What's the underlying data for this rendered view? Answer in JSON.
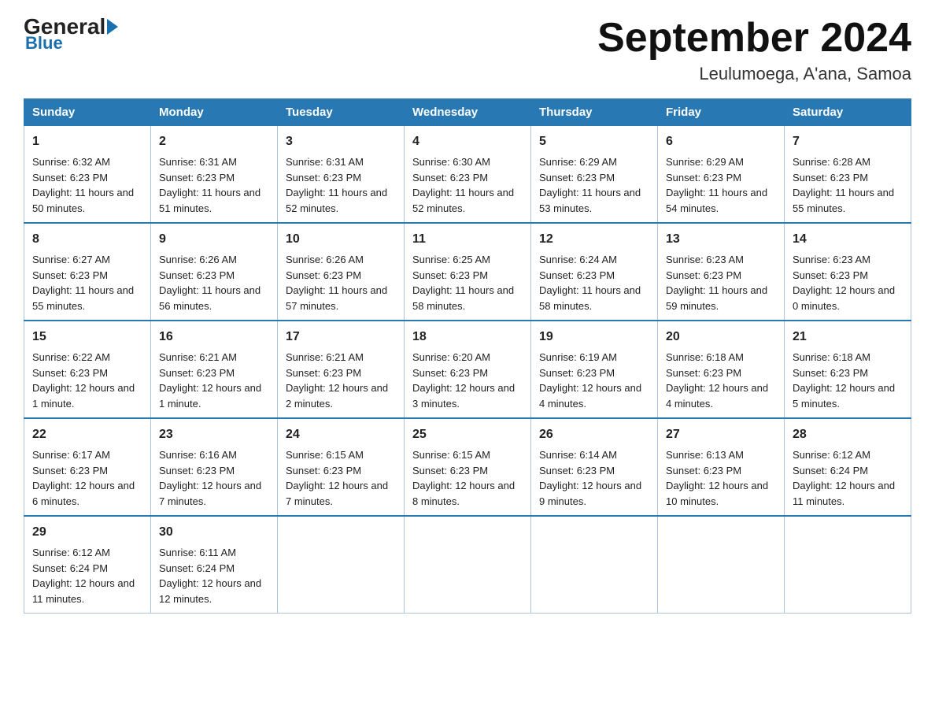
{
  "header": {
    "logo_main": "General",
    "logo_sub": "Blue",
    "title": "September 2024",
    "subtitle": "Leulumoega, A'ana, Samoa"
  },
  "days_of_week": [
    "Sunday",
    "Monday",
    "Tuesday",
    "Wednesday",
    "Thursday",
    "Friday",
    "Saturday"
  ],
  "weeks": [
    [
      {
        "day": "1",
        "sunrise": "6:32 AM",
        "sunset": "6:23 PM",
        "daylight": "11 hours and 50 minutes."
      },
      {
        "day": "2",
        "sunrise": "6:31 AM",
        "sunset": "6:23 PM",
        "daylight": "11 hours and 51 minutes."
      },
      {
        "day": "3",
        "sunrise": "6:31 AM",
        "sunset": "6:23 PM",
        "daylight": "11 hours and 52 minutes."
      },
      {
        "day": "4",
        "sunrise": "6:30 AM",
        "sunset": "6:23 PM",
        "daylight": "11 hours and 52 minutes."
      },
      {
        "day": "5",
        "sunrise": "6:29 AM",
        "sunset": "6:23 PM",
        "daylight": "11 hours and 53 minutes."
      },
      {
        "day": "6",
        "sunrise": "6:29 AM",
        "sunset": "6:23 PM",
        "daylight": "11 hours and 54 minutes."
      },
      {
        "day": "7",
        "sunrise": "6:28 AM",
        "sunset": "6:23 PM",
        "daylight": "11 hours and 55 minutes."
      }
    ],
    [
      {
        "day": "8",
        "sunrise": "6:27 AM",
        "sunset": "6:23 PM",
        "daylight": "11 hours and 55 minutes."
      },
      {
        "day": "9",
        "sunrise": "6:26 AM",
        "sunset": "6:23 PM",
        "daylight": "11 hours and 56 minutes."
      },
      {
        "day": "10",
        "sunrise": "6:26 AM",
        "sunset": "6:23 PM",
        "daylight": "11 hours and 57 minutes."
      },
      {
        "day": "11",
        "sunrise": "6:25 AM",
        "sunset": "6:23 PM",
        "daylight": "11 hours and 58 minutes."
      },
      {
        "day": "12",
        "sunrise": "6:24 AM",
        "sunset": "6:23 PM",
        "daylight": "11 hours and 58 minutes."
      },
      {
        "day": "13",
        "sunrise": "6:23 AM",
        "sunset": "6:23 PM",
        "daylight": "11 hours and 59 minutes."
      },
      {
        "day": "14",
        "sunrise": "6:23 AM",
        "sunset": "6:23 PM",
        "daylight": "12 hours and 0 minutes."
      }
    ],
    [
      {
        "day": "15",
        "sunrise": "6:22 AM",
        "sunset": "6:23 PM",
        "daylight": "12 hours and 1 minute."
      },
      {
        "day": "16",
        "sunrise": "6:21 AM",
        "sunset": "6:23 PM",
        "daylight": "12 hours and 1 minute."
      },
      {
        "day": "17",
        "sunrise": "6:21 AM",
        "sunset": "6:23 PM",
        "daylight": "12 hours and 2 minutes."
      },
      {
        "day": "18",
        "sunrise": "6:20 AM",
        "sunset": "6:23 PM",
        "daylight": "12 hours and 3 minutes."
      },
      {
        "day": "19",
        "sunrise": "6:19 AM",
        "sunset": "6:23 PM",
        "daylight": "12 hours and 4 minutes."
      },
      {
        "day": "20",
        "sunrise": "6:18 AM",
        "sunset": "6:23 PM",
        "daylight": "12 hours and 4 minutes."
      },
      {
        "day": "21",
        "sunrise": "6:18 AM",
        "sunset": "6:23 PM",
        "daylight": "12 hours and 5 minutes."
      }
    ],
    [
      {
        "day": "22",
        "sunrise": "6:17 AM",
        "sunset": "6:23 PM",
        "daylight": "12 hours and 6 minutes."
      },
      {
        "day": "23",
        "sunrise": "6:16 AM",
        "sunset": "6:23 PM",
        "daylight": "12 hours and 7 minutes."
      },
      {
        "day": "24",
        "sunrise": "6:15 AM",
        "sunset": "6:23 PM",
        "daylight": "12 hours and 7 minutes."
      },
      {
        "day": "25",
        "sunrise": "6:15 AM",
        "sunset": "6:23 PM",
        "daylight": "12 hours and 8 minutes."
      },
      {
        "day": "26",
        "sunrise": "6:14 AM",
        "sunset": "6:23 PM",
        "daylight": "12 hours and 9 minutes."
      },
      {
        "day": "27",
        "sunrise": "6:13 AM",
        "sunset": "6:23 PM",
        "daylight": "12 hours and 10 minutes."
      },
      {
        "day": "28",
        "sunrise": "6:12 AM",
        "sunset": "6:24 PM",
        "daylight": "12 hours and 11 minutes."
      }
    ],
    [
      {
        "day": "29",
        "sunrise": "6:12 AM",
        "sunset": "6:24 PM",
        "daylight": "12 hours and 11 minutes."
      },
      {
        "day": "30",
        "sunrise": "6:11 AM",
        "sunset": "6:24 PM",
        "daylight": "12 hours and 12 minutes."
      },
      null,
      null,
      null,
      null,
      null
    ]
  ],
  "labels": {
    "sunrise": "Sunrise:",
    "sunset": "Sunset:",
    "daylight": "Daylight:"
  }
}
